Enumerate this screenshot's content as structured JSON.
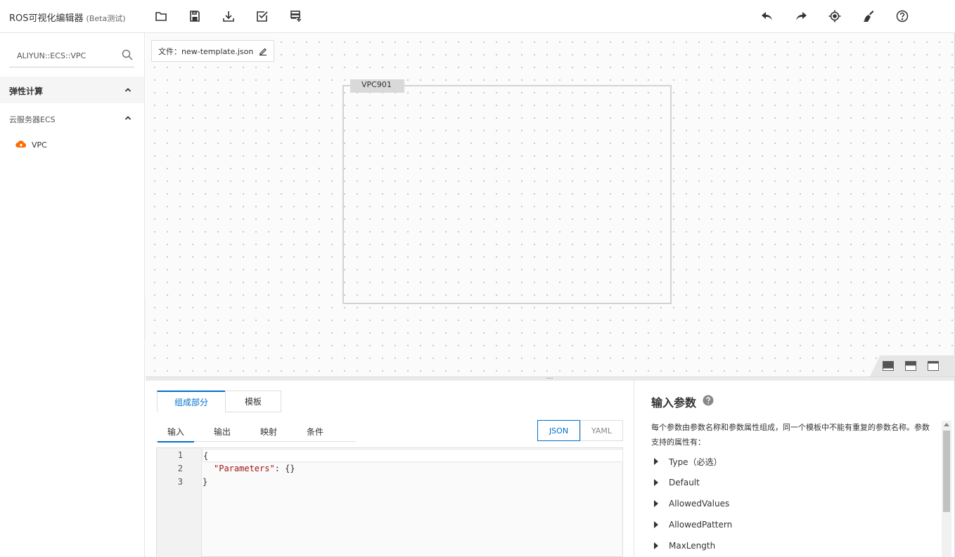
{
  "header": {
    "title": "ROS可视化编辑器",
    "beta": "(Beta测试)"
  },
  "toolbar_left_icons": [
    "folder-open-icon",
    "save-icon",
    "download-icon",
    "validate-icon",
    "add-template-icon"
  ],
  "toolbar_right_icons": [
    "undo-icon",
    "redo-icon",
    "locate-icon",
    "clear-icon",
    "help-icon"
  ],
  "sidebar": {
    "search_value": "ALIYUN::ECS::VPC",
    "category": "弹性计算",
    "subcategory": "云服务器ECS",
    "resource": "VPC"
  },
  "canvas": {
    "file_label": "文件：new-template.json",
    "vpc_label": "VPC901"
  },
  "editor_panel": {
    "tabs": [
      "组成部分",
      "模板"
    ],
    "subtabs": [
      "输入",
      "输出",
      "映射",
      "条件"
    ],
    "formats": [
      "JSON",
      "YAML"
    ],
    "line_numbers": [
      "1",
      "2",
      "3"
    ],
    "code_line1": "{",
    "code_key": "\"Parameters\"",
    "code_rest": ": {}",
    "code_line3": "}"
  },
  "info_panel": {
    "title": "输入参数",
    "description": "每个参数由参数名称和参数属性组成，同一个模板中不能有重复的参数名称。参数支持的属性有：",
    "properties": [
      "Type（必选）",
      "Default",
      "AllowedValues",
      "AllowedPattern",
      "MaxLength"
    ]
  },
  "colors": {
    "accent": "#0070cc",
    "vpc_icon": "#ff6a00"
  }
}
